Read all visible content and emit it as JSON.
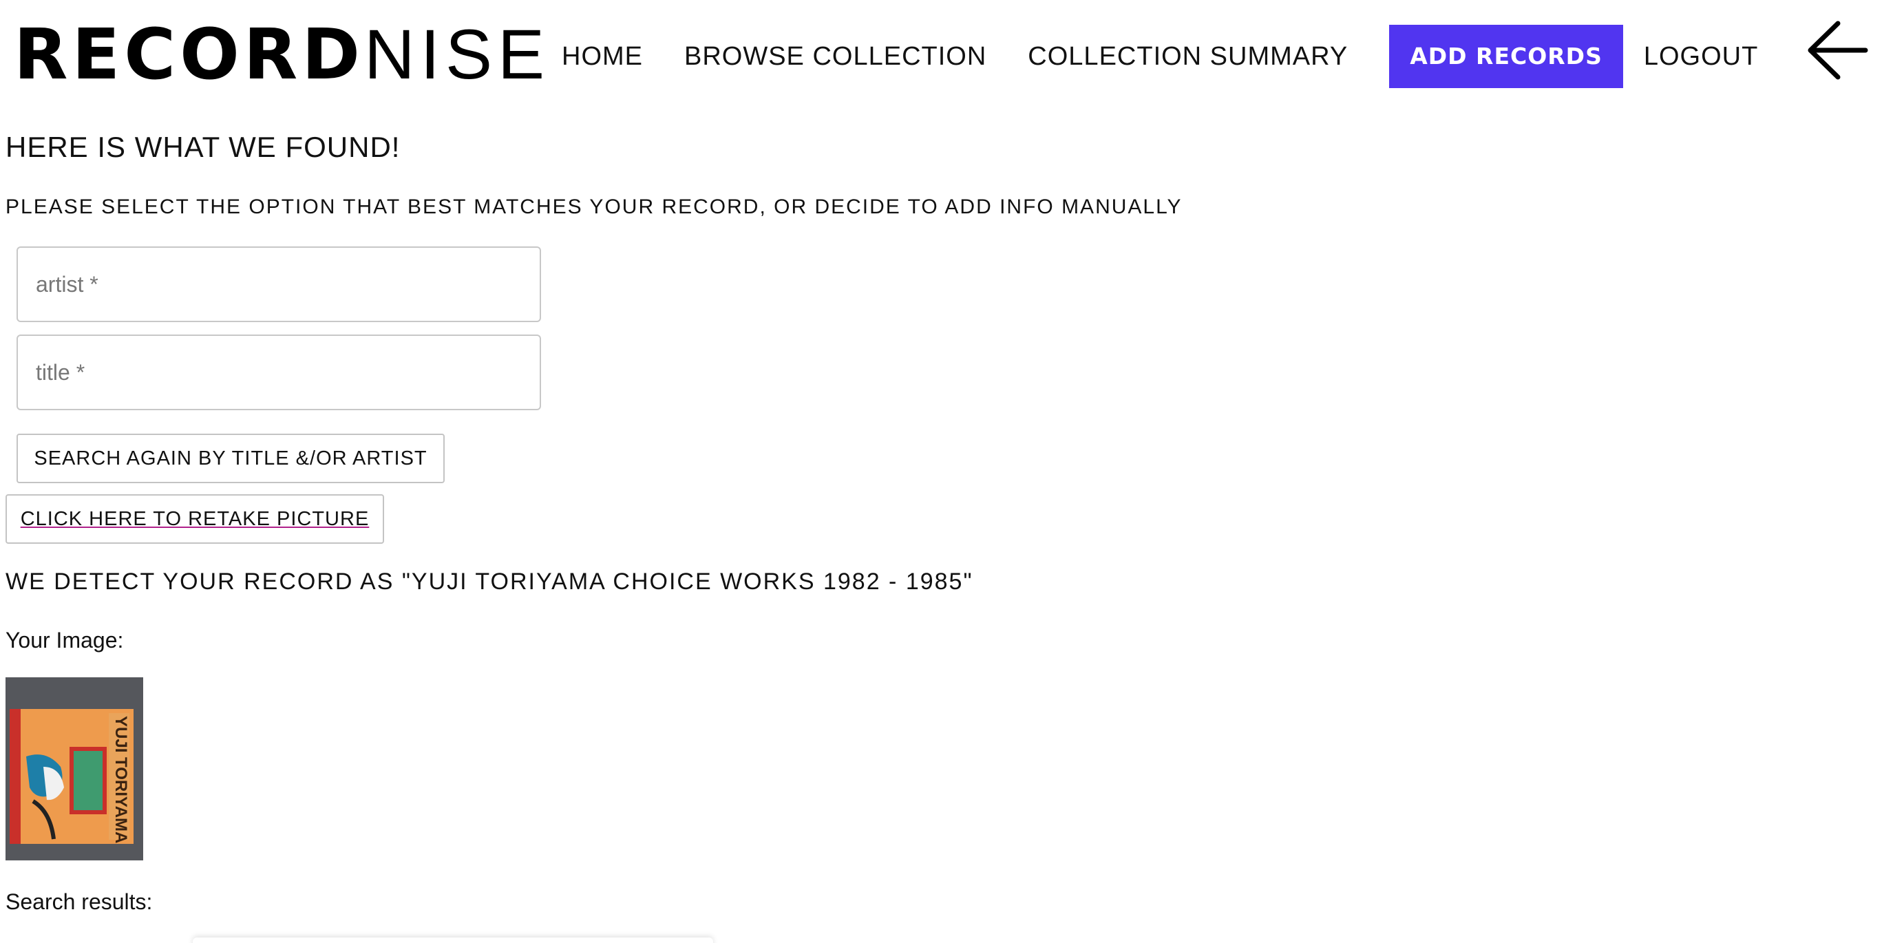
{
  "header": {
    "logo_bold": "RECORD",
    "logo_light": "NISE",
    "nav": [
      {
        "label": "HOME"
      },
      {
        "label": "BROWSE COLLECTION"
      },
      {
        "label": "COLLECTION SUMMARY"
      },
      {
        "label": "ADD RECORDS"
      },
      {
        "label": "LOGOUT"
      }
    ],
    "back_icon": "arrow-left-icon"
  },
  "main": {
    "heading": "HERE IS WHAT WE FOUND!",
    "subheading": "PLEASE SELECT THE OPTION THAT BEST MATCHES YOUR RECORD, OR DECIDE TO ADD INFO MANUALLY",
    "artist_field": {
      "placeholder": "artist *",
      "value": ""
    },
    "title_field": {
      "placeholder": "title *",
      "value": ""
    },
    "search_again_label": "SEARCH AGAIN BY TITLE &/OR ARTIST",
    "retake_label": "CLICK HERE TO RETAKE PICTURE",
    "detected_text": "WE DETECT YOUR RECORD AS \"YUJI TORIYAMA CHOICE WORKS 1982 - 1985\"",
    "your_image_label": "Your Image:",
    "thumbnail": {
      "spine_text": "YUJI TORIYAMA"
    },
    "search_results_label": "Search results:"
  },
  "colors": {
    "accent": "#5135f0",
    "text": "#111111",
    "border": "#c8c8c8"
  }
}
